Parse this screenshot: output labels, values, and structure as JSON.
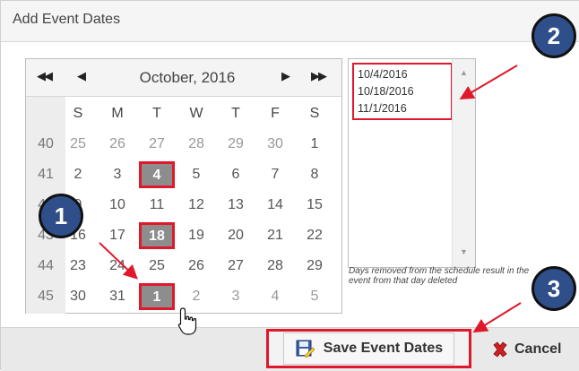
{
  "dialog": {
    "title": "Add Event Dates"
  },
  "calendar": {
    "month_title": "October, 2016",
    "nav": {
      "first": "◀◀",
      "prev": "◀",
      "next": "▶",
      "last": "▶▶"
    },
    "weekdays": [
      "S",
      "M",
      "T",
      "W",
      "T",
      "F",
      "S"
    ],
    "weeks": [
      {
        "week": "40",
        "days": [
          {
            "d": "25",
            "o": true
          },
          {
            "d": "26",
            "o": true
          },
          {
            "d": "27",
            "o": true
          },
          {
            "d": "28",
            "o": true
          },
          {
            "d": "29",
            "o": true
          },
          {
            "d": "30",
            "o": true
          },
          {
            "d": "1",
            "o": false
          }
        ]
      },
      {
        "week": "41",
        "days": [
          {
            "d": "2",
            "o": false
          },
          {
            "d": "3",
            "o": false
          },
          {
            "d": "4",
            "o": false,
            "s": true
          },
          {
            "d": "5",
            "o": false
          },
          {
            "d": "6",
            "o": false
          },
          {
            "d": "7",
            "o": false
          },
          {
            "d": "8",
            "o": false
          }
        ]
      },
      {
        "week": "42",
        "days": [
          {
            "d": "9",
            "o": false
          },
          {
            "d": "10",
            "o": false
          },
          {
            "d": "11",
            "o": false
          },
          {
            "d": "12",
            "o": false
          },
          {
            "d": "13",
            "o": false
          },
          {
            "d": "14",
            "o": false
          },
          {
            "d": "15",
            "o": false
          }
        ]
      },
      {
        "week": "43",
        "days": [
          {
            "d": "16",
            "o": false
          },
          {
            "d": "17",
            "o": false
          },
          {
            "d": "18",
            "o": false,
            "s": true
          },
          {
            "d": "19",
            "o": false
          },
          {
            "d": "20",
            "o": false
          },
          {
            "d": "21",
            "o": false
          },
          {
            "d": "22",
            "o": false
          }
        ]
      },
      {
        "week": "44",
        "days": [
          {
            "d": "23",
            "o": false
          },
          {
            "d": "24",
            "o": false
          },
          {
            "d": "25",
            "o": false
          },
          {
            "d": "26",
            "o": false
          },
          {
            "d": "27",
            "o": false
          },
          {
            "d": "28",
            "o": false
          },
          {
            "d": "29",
            "o": false
          }
        ]
      },
      {
        "week": "45",
        "days": [
          {
            "d": "30",
            "o": false
          },
          {
            "d": "31",
            "o": false
          },
          {
            "d": "1",
            "o": true,
            "s": true
          },
          {
            "d": "2",
            "o": true
          },
          {
            "d": "3",
            "o": true
          },
          {
            "d": "4",
            "o": true
          },
          {
            "d": "5",
            "o": true
          }
        ]
      }
    ]
  },
  "selected_dates": [
    "10/4/2016",
    "10/18/2016",
    "11/1/2016"
  ],
  "note": "Days removed from the schedule result in the event from that day deleted",
  "footer": {
    "save_label": "Save Event Dates",
    "cancel_label": "Cancel"
  },
  "callouts": [
    "1",
    "2",
    "3"
  ],
  "colors": {
    "highlight_red": "#e0182b",
    "badge_blue": "#2f4f8a",
    "selected_day_bg": "#8d8d8d"
  },
  "icons": {
    "save": "save-icon",
    "cancel": "cancel-x-icon",
    "cursor": "hand-pointer-icon"
  }
}
